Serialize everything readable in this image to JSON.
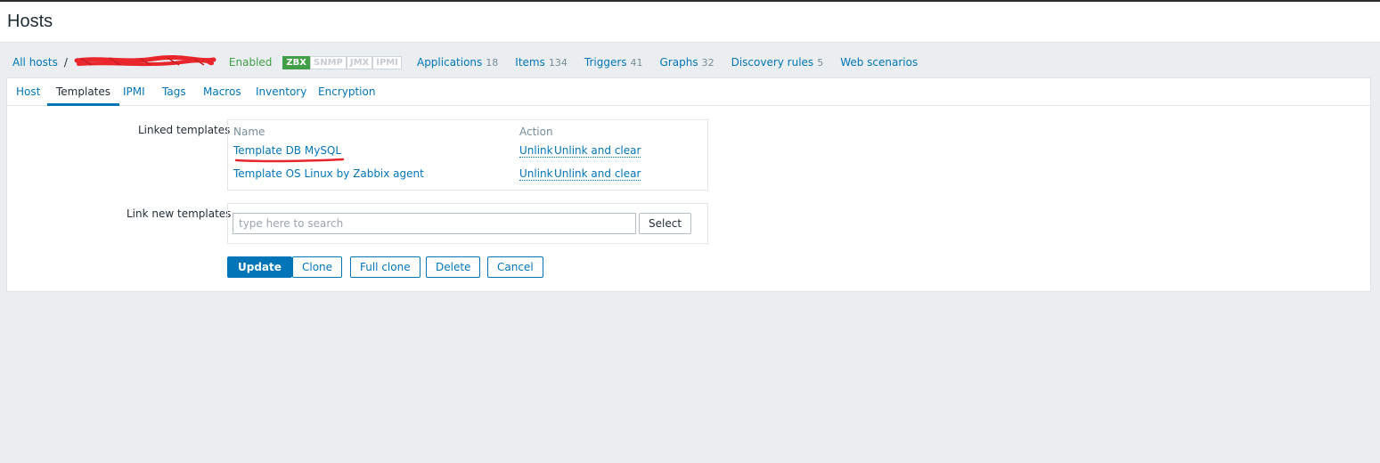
{
  "header": {
    "title": "Hosts"
  },
  "breadcrumb": {
    "all_hosts": "All hosts",
    "separator": "/",
    "status": "Enabled",
    "availability": [
      "ZBX",
      "SNMP",
      "JMX",
      "IPMI"
    ],
    "availability_active": "ZBX",
    "links": [
      {
        "label": "Applications",
        "count": "18"
      },
      {
        "label": "Items",
        "count": "134"
      },
      {
        "label": "Triggers",
        "count": "41"
      },
      {
        "label": "Graphs",
        "count": "32"
      },
      {
        "label": "Discovery rules",
        "count": "5"
      },
      {
        "label": "Web scenarios",
        "count": ""
      }
    ]
  },
  "tabs": [
    "Host",
    "Templates",
    "IPMI",
    "Tags",
    "Macros",
    "Inventory",
    "Encryption"
  ],
  "active_tab": "Templates",
  "linked_templates": {
    "label": "Linked templates",
    "col_name": "Name",
    "col_action": "Action",
    "rows": [
      {
        "name": "Template DB MySQL",
        "unlink": "Unlink",
        "unlink_clear": "Unlink and clear"
      },
      {
        "name": "Template OS Linux by Zabbix agent",
        "unlink": "Unlink",
        "unlink_clear": "Unlink and clear"
      }
    ]
  },
  "link_new": {
    "label": "Link new templates",
    "placeholder": "type here to search",
    "select_label": "Select"
  },
  "buttons": {
    "update": "Update",
    "clone": "Clone",
    "full_clone": "Full clone",
    "delete": "Delete",
    "cancel": "Cancel"
  },
  "colors": {
    "link": "#0275b8",
    "enabled": "#429e47",
    "background": "#ebeef0",
    "redaction": "#e8262c"
  }
}
